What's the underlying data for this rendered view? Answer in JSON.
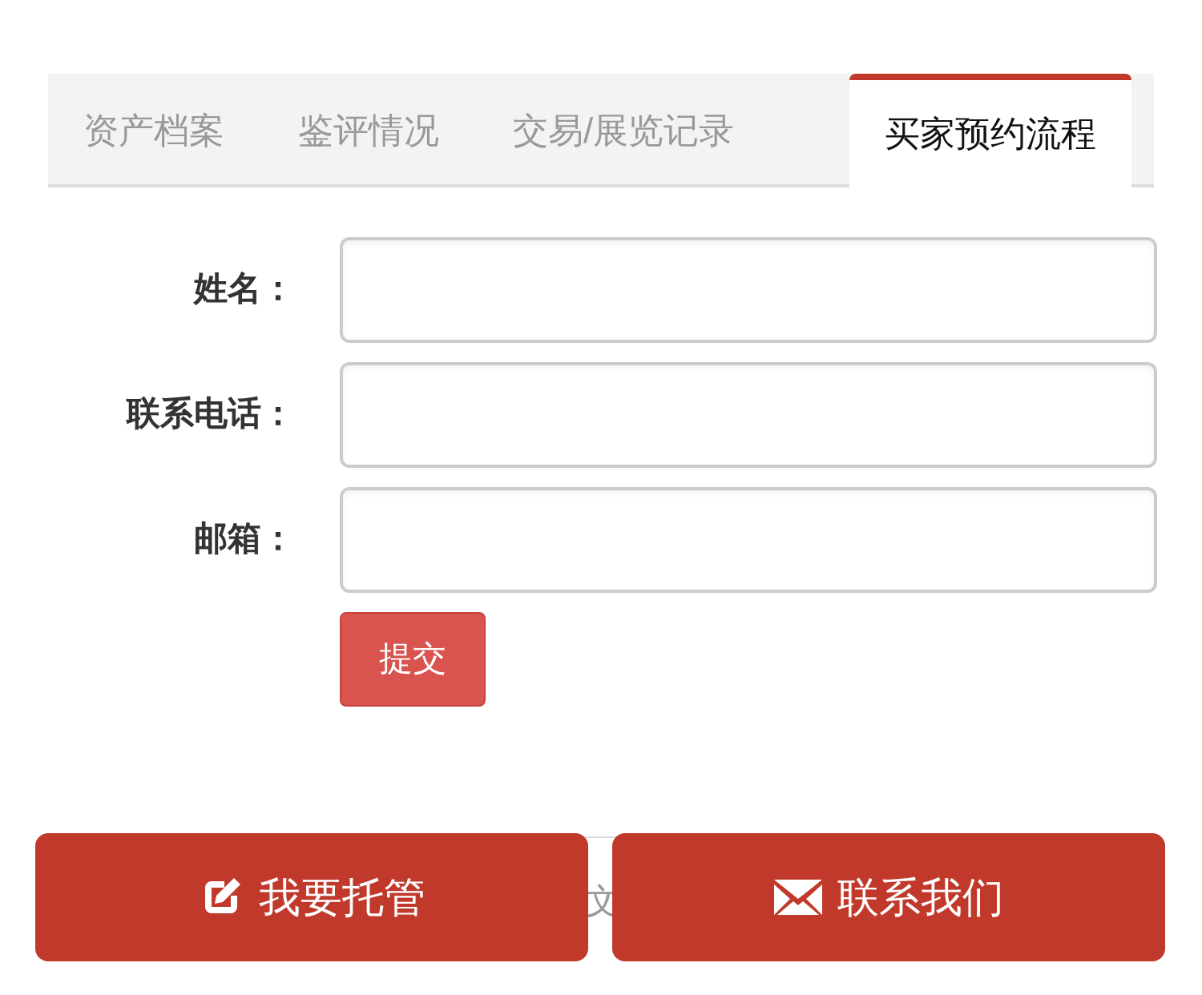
{
  "tabs": [
    {
      "label": "资产档案",
      "selected": false
    },
    {
      "label": "鉴评情况",
      "selected": false
    },
    {
      "label": "交易/展览记录",
      "selected": false
    },
    {
      "label": "买家预约流程",
      "selected": true
    }
  ],
  "form": {
    "fields": [
      {
        "label": "姓名："
      },
      {
        "label": "联系电话："
      },
      {
        "label": "邮箱："
      }
    ],
    "submit": "提交"
  },
  "hidden_text": "文",
  "bottom_buttons": [
    {
      "kind": "edit",
      "label": "我要托管"
    },
    {
      "kind": "mail",
      "label": "联系我们"
    }
  ]
}
